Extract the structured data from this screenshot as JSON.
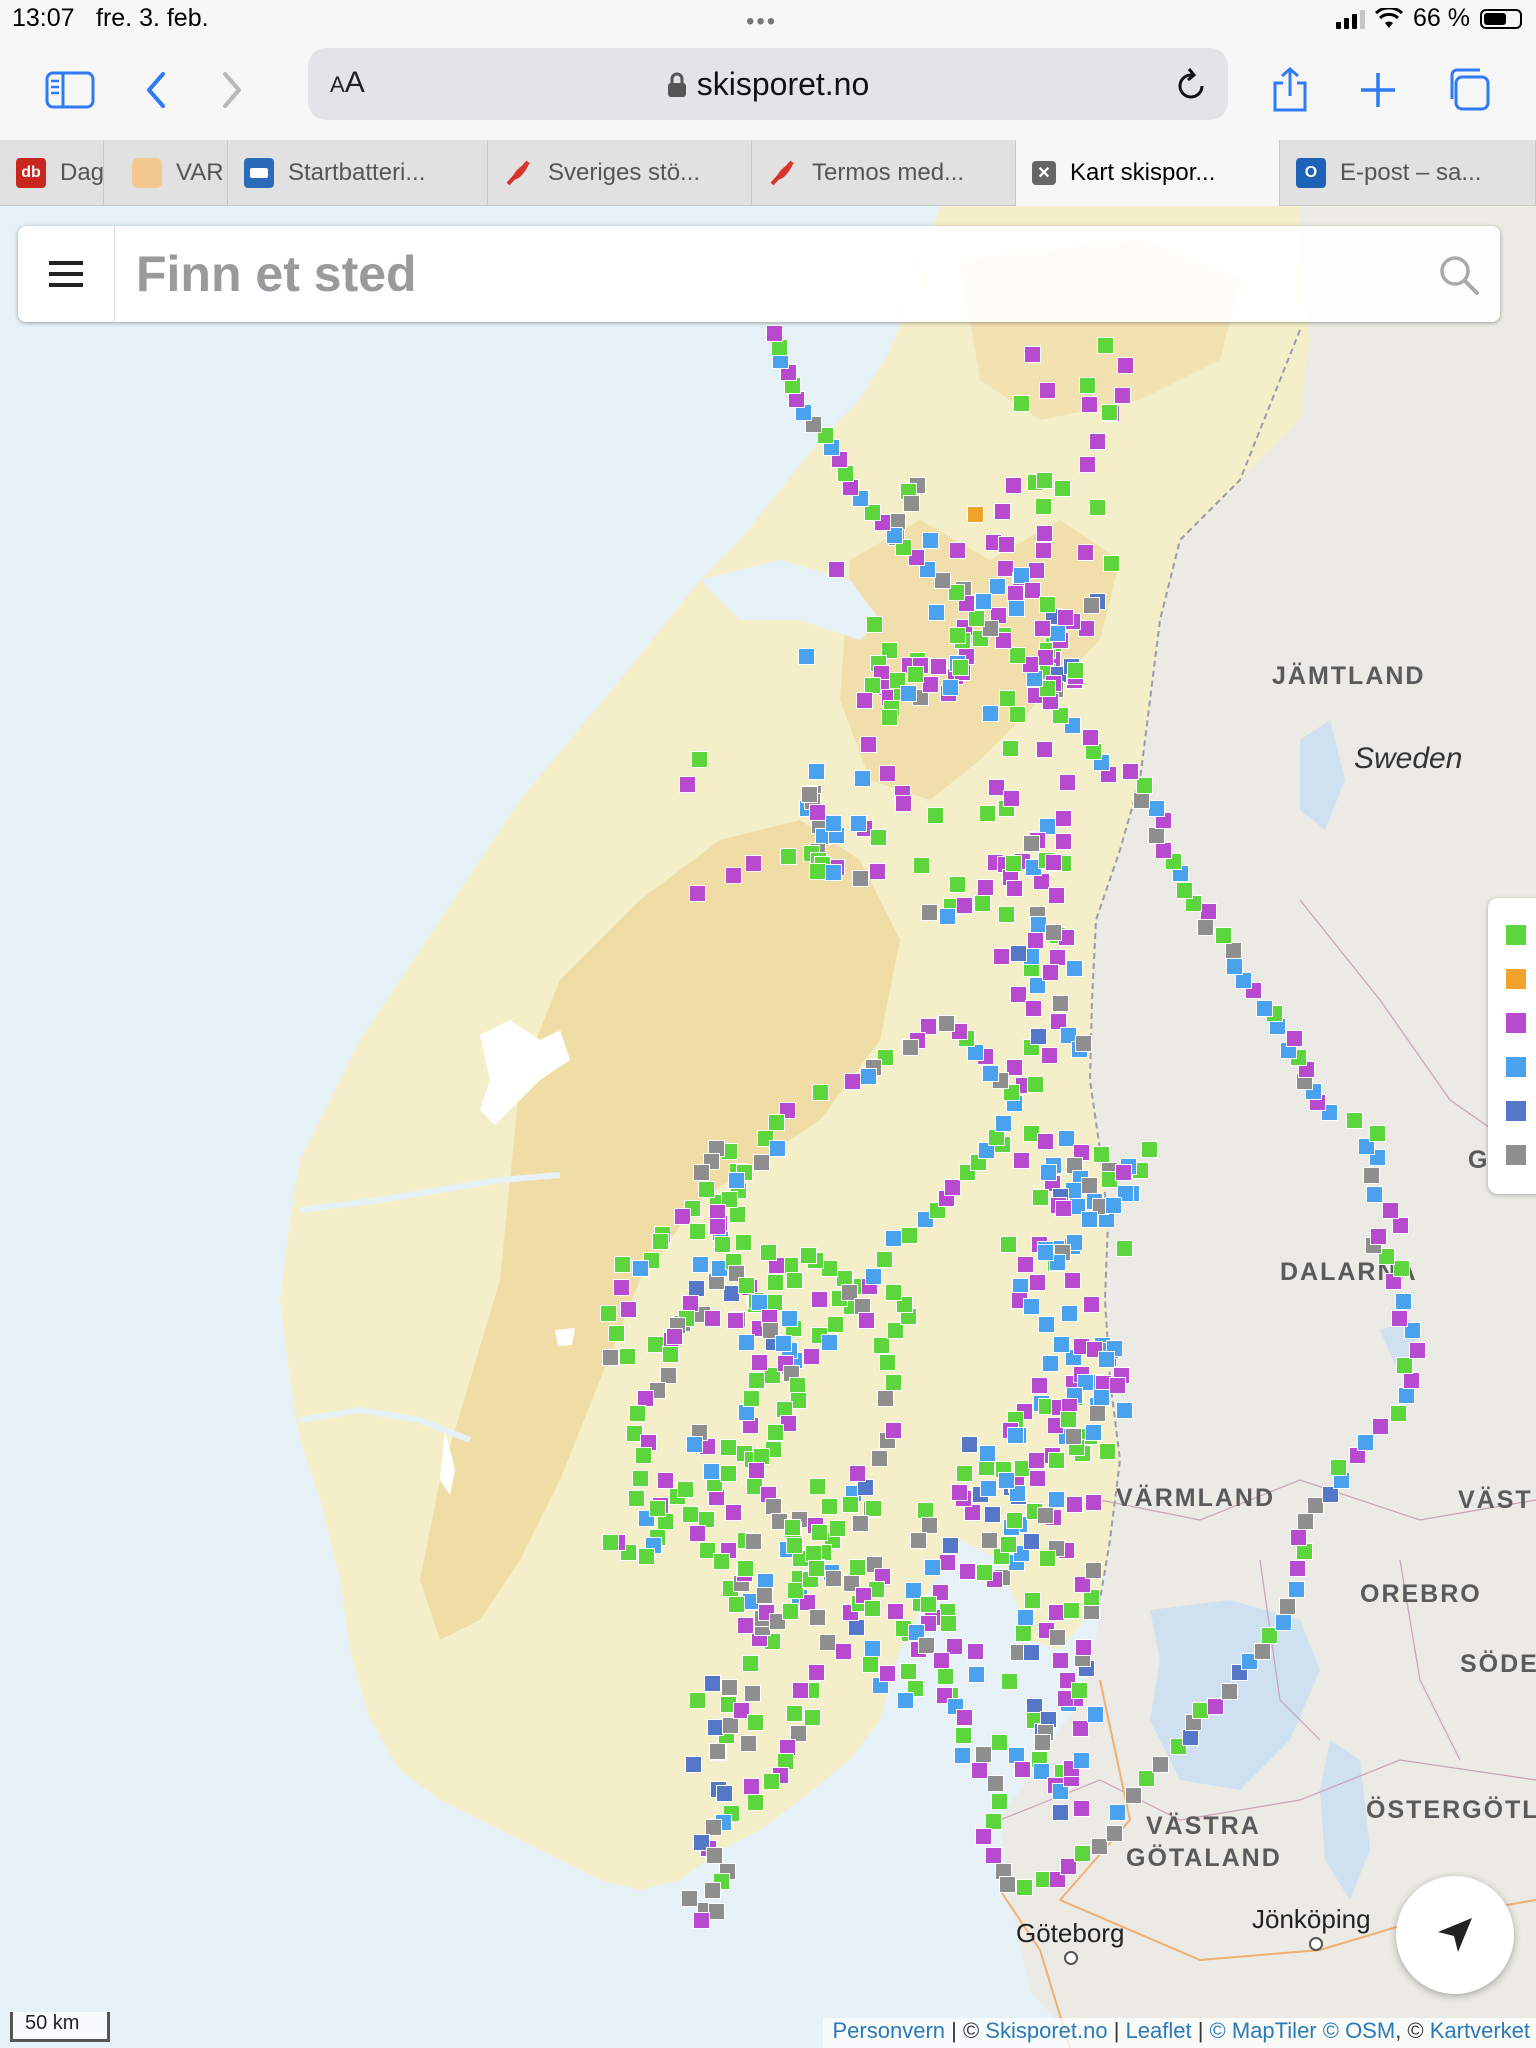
{
  "status_bar": {
    "time": "13:07",
    "date": "fre. 3. feb.",
    "battery": "66 %",
    "battery_level": 0.66
  },
  "browser": {
    "aa_label": "AA",
    "url": "skisporet.no",
    "tabs": [
      {
        "title": "Dag",
        "icon": "db-favicon",
        "color": "#c8261e",
        "text": "db"
      },
      {
        "title": "VAR",
        "icon": "var-favicon",
        "color": "#f2b86a",
        "text": ""
      },
      {
        "title": "Startbatteri...",
        "icon": "startbatteri-favicon",
        "color": "#2c6bb8",
        "text": ""
      },
      {
        "title": "Sveriges stö...",
        "icon": "feather-favicon",
        "color": "#d9332b",
        "text": ""
      },
      {
        "title": "Termos med...",
        "icon": "feather-favicon",
        "color": "#d9332b",
        "text": ""
      },
      {
        "title": "Kart skispor...",
        "icon": "close-tab-icon",
        "color": "#666666",
        "text": "",
        "active": true
      },
      {
        "title": "E-post – sa...",
        "icon": "outlook-favicon",
        "color": "#1e62b8",
        "text": ""
      }
    ]
  },
  "search": {
    "placeholder": "Finn et sted"
  },
  "map_labels": {
    "jamtland": "JÄMTLAND",
    "sweden": "Sweden",
    "dalarna": "DALARNA",
    "varmland": "VÄRMLAND",
    "vast": "VÄST",
    "orebro": "OREBRO",
    "sode": "SÖDE",
    "vastra_gotaland_1": "VÄSTRA",
    "vastra_gotaland_2": "GÖTALAND",
    "ostergotl": "ÖSTERGÖTL",
    "goteborg": "Göteborg",
    "jonkoping": "Jönköping",
    "g_partial": "G"
  },
  "legend_colors": [
    "#5cd63c",
    "#f0a22a",
    "#b84ad0",
    "#4aa2ef",
    "#5577c8",
    "#8e8e8e"
  ],
  "marker_palette": {
    "g": "#5cd63c",
    "o": "#f0a22a",
    "p": "#b84ad0",
    "b": "#4aa2ef",
    "d": "#5577c8",
    "y": "#8e8e8e"
  },
  "markers": "p1032,354 g1105,345 p1125,365 p1047,390 g1087,385 g1021,403 p1089,404 p1122,395 p1111,413 g1109,412 p1097,441 p1087,464 p1013,485 g1035,482 g1044,480 g1062,488 y917,485 o975,514 p1002,511 g1043,506 g1097,507 g908,491 y911,503 y897,521 y896,537 b930,540 p957,550 p993,542 p1006,544 p1043,550 p1044,533 p1085,552 g1111,563 p1036,570 p1005,568 p1020,580 p836,569 y963,589 b997,586 p1015,593 b1016,608 b1021,575 p1032,590 p1086,628 d1097,601 y1091,605 p1072,621 p964,627 g1003,635 p998,615 b983,601 b936,612 g1003,635 g874,624 g889,650 g917,660 p939,666 p966,656 g980,638 p1058,638 g1053,645 p1052,659 g1047,671 p909,665 g878,663 p881,673 p886,687 p889,697 g901,693 g897,680 p920,665 p938,666 p955,676 p948,693 y920,697 b908,693 p930,684 p962,672 b950,687 g915,674 g872,685 b957,663 g962,640 g960,667 g891,708 p864,700 g889,717 d1058,674 p1074,680 y1055,689 p1075,676 d1071,666 g1047,650 d1053,616 p1065,617 g957,635 b990,713 g1017,714 p1053,683 p1035,695 g1075,670 p1045,657 p1060,640 b1057,633 p1042,628 g1047,604 g1007,698 g1010,748 p1044,749 p1067,782 p996,787 g1006,808 p1063,818 y1037,839 b1047,826 p1063,841 g1058,863 p1041,881 b806,656 g699,759 p687,784 b816,771 b862,778 p868,744 p887,773 p902,793 g935,815 g951,906 y929,912 p964,905 b947,916 p995,862 p1005,864 p1022,861 b1033,867 g1063,863 p1010,877 p1014,888 p1037,840 g1046,860 p1053,862 y1031,843 g957,884 p877,871 p836,867 g788,856 p753,863 p697,893 p733,875 y813,793 y819,825 b823,836 b807,808 y812,801 y817,851 p864,828 g811,853 b836,835 g818,860 g822,864 g817,871 b833,872 y860,878 p817,812 y809,794 b858,823 b833,823 p903,803 g878,837 g921,865 g987,813 p1011,798 g1013,863 p985,887 g982,903 g1006,914 p1056,895 y1037,914 g1057,935 p1001,956 b1038,924 p1066,937 p1018,994 g1031,968 b1037,985 y1053,932 p1035,940 b1031,956 p1057,957 b1074,968 d1018,953 p1050,972 p1033,1008 p1058,1021 b1068,1035 b1079,1049 y1060,1003 g1031,1047 y1083,1043 p1023,1085 p1049,1055 g1035,1084 d1038,1036 p1014,1067 b1066,1138 g1031,1133 p1045,1141 g1002,1144 p1021,1160 p1081,1152 b1053,1165 y1074,1165 y1109,1170 b1080,1178 p1052,1183 g1101,1154 b1073,1190 y1089,1185 b1048,1172 d1060,1196 g1040,1197 p1058,1205 b1077,1206 g1109,1179 b1094,1201 b1106,1219 p1063,1208 p1039,1244 b1061,1248 b1072,1246 g1149,1149 g1140,1170 b1128,1166 p1123,1172 b1131,1193 y1100,1206 b1125,1193 b1113,1205 b1089,1219 b1074,1242 g1124,1248 g1055,1263 b1045,1249 y1062,1252 p1072,1280 b1057,1262 b1045,1252 p1025,1264 g1008,1244 b1020,1286 p1037,1282 p1019,1300 b1031,1306 b1046,1324 b1069,1313 p1091,1304 b1073,1357 b1061,1344 p1073,1383 p1081,1346 b1050,1363 p1039,1385 b1041,1403 p1024,1411 g1015,1419 g1046,1406 p1059,1407 b1066,1436 b1094,1382 p1108,1358 b1097,1405 g1089,1436 p1055,1425 g1082,1453 g1107,1451 g986,1467 b1018,1435 p1010,1430 d1011,1487 g1022,1468 p1053,1517 p1093,1502 y1097,1413 b1093,1432 p1103,1383 b1102,1345 b1110,1350 p1094,1349 g1075,1397 p1081,1374 p1121,1375 b1114,1348 b1106,1359 b1085,1382 b1074,1395 b1101,1397 p1117,1385 b1124,1410 p1069,1406 g1068,1419 p1036,1460 g1003,1469 p1016,1484 d1018,1496 d980,1494 d992,1514 p972,1512 y989,1540 d950,1545 p967,1571 y1002,1577 b1016,1562 p994,1579 g1001,1556 b1021,1553 g984,1572 p940,1592 g920,1603 b913,1590 g947,1611 g948,1623 p932,1617 p954,1646 g950,1695 g1009,1681 b976,1674 p975,1651 y1018,1652 g1023,1633 b1025,1617 g1032,1600 p1046,1630 d1031,1652 p1060,1660 p1067,1680 b1068,1703 d1034,1706 g1034,1720 d1042,1731 d1048,1719 y1045,1732 y1042,1742 g999,1742 b1016,1755 y983,1754 p1022,1769 g1039,1759 b1041,1771 g1062,1772 p1055,1785 p1081,1808 b1060,1791 d1060,1812 p1071,1778 p1071,1768 b1081,1760 p1080,1728 b1095,1714 p1075,1698 p1065,1698 g1079,1690 d1086,1668 y1082,1658 p1083,1647 y1057,1637 p1056,1612 y1091,1611 g1071,1610 g1091,1597 p1082,1584 y1093,1570 p1066,1550 y1056,1548 g1047,1558 d1031,1541 b1019,1524 b1011,1527 g1008,1544 g1014,1520 b1017,1493 g1034,1511 y1045,1515 b1056,1499 p1074,1504 p1037,1478 b1006,1480 b988,1488 p963,1498 b987,1453 p1052,1455 g1056,1460 g1076,1447 y1073,1436 b1015,1435 d969,1444 g964,1473 p959,1492 g925,1510 y929,1525 y918,1540 p947,1562 b932,1567 g928,1604 p928,1623 g909,1633 p918,1649 g908,1671 g915,1688 b905,1700 b880,1685 p887,1673 g870,1664 b872,1648 d856,1627 p850,1612 g859,1603 p851,1582 g857,1567 y874,1564 p882,1576 g876,1589 y871,1509 g873,1508 g829,1506 b853,1493 g817,1486 y799,1519 p815,1525 g832,1540 g823,1552 b831,1572 p816,1567 g799,1578 b787,1549 b799,1597 p807,1602 y817,1617 y827,1642 p843,1651 p816,1672 g811,1690 p800,1690 g794,1713 g812,1717 y798,1733 p787,1747 g785,1761 p780,1775 g771,1781 p751,1786 g755,1802 g731,1813 b723,1822 y713,1827 p708,1848 d701,1842 y714,1855 y727,1871 g721,1881 y712,1890 y689,1898 y705,1910 y716,1911 p701,1920 d718,1789 d724,1793 d693,1764 g718,1752 g726,1735 y717,1751 y748,1743 d715,1727 y730,1725 g697,1700 g728,1704 d712,1683 y729,1687 y752,1693 p741,1710 g755,1722 g750,1663 g772,1641 p759,1638 y762,1627 p745,1625 y762,1618 b750,1601 g736,1604 g730,1588 y741,1583 p744,1573 p728,1550 g745,1540 y753,1541 p733,1512 p716,1497 g714,1483 g728,1473 b711,1471 p707,1446 y699,1432 b694,1444 g728,1447 g744,1453 g752,1459 p750,1425 b746,1412 g751,1398 g756,1380 g772,1375 y789,1366 b794,1360 b789,1350 p811,1356 g819,1335 g835,1324 g851,1306 g861,1286 g844,1278 g829,1268 g815,1260 g808,1255 g790,1265 g794,1280 p819,1299 g839,1298 y849,1292 y862,1306 p866,1320 b829,1342 g793,1328 p759,1328 y737,1319 g755,1304 p749,1287 g775,1282 p776,1265 g768,1252 g743,1242 b720,1232 g737,1214 p719,1223 g717,1202 g738,1190 g737,1171 g729,1151 y716,1148 y711,1161 y701,1172 g706,1189 g692,1208 p682,1216 g697,1231 g662,1234 g660,1241 g651,1260 b640,1268 g622,1264 p621,1287 p628,1309 g608,1313 g616,1333 y610,1357 g627,1356 g655,1344 p671,1340 y682,1323 y702,1314 p712,1318 p735,1320 b746,1342 p759,1362 d773,1342 b789,1318 g774,1302 g756,1300 d731,1293 y716,1281 b719,1268 b700,1264 d696,1288 p690,1303 g686,1318 y677,1325 p674,1336 g670,1354 y668,1375 y657,1390 p645,1398 g637,1413 g634,1433 p648,1442 g643,1455 g640,1478 g636,1498 p660,1505 g665,1521 g657,1537 b653,1545 g646,1556 g628,1552 p617,1542 g610,1542 b646,1518 g657,1508 g677,1496 p665,1480 g685,1489 g690,1514 g706,1519 p697,1533 g707,1550 g721,1561 g745,1568 b765,1581 y764,1595 p766,1612 y777,1621 g790,1611 g795,1590 g810,1579 g800,1558 g793,1529 g819,1532 g837,1528 y860,1523 g850,1504 d865,1487 p857,1473 y879,1458 y887,1440 p893,1430 y885,1398 g893,1382 g887,1362 g881,1345 g895,1330 g908,1316 g904,1304 g893,1292 p869,1286 b873,1276 g884,1259 b893,1238 g909,1235 b925,1219 g937,1210 p946,1198 p952,1187 g967,1172 g978,1162 b986,1150 g996,1137 b1003,1123 b1014,1103 g1011,1092 y1000,1080 b990,1073 p985,1056 b975,1052 g966,1038 p959,1031 y946,1023 p928,1026 p917,1040 y910,1047 g885,1057 y873,1067 b868,1076 p852,1081 g820,1092 p787,1110 g776,1122 g765,1138 b777,1148 y761,1162 g744,1172 b736,1180 g729,1199 p717,1212 p717,1226 g722,1244 g733,1261 y736,1273 g746,1285 b759,1302 p769,1317 y770,1330 b783,1343 p785,1363 y791,1373 g797,1385 g798,1400 g784,1409 p788,1423 g775,1432 g773,1449 g761,1456 p756,1470 g754,1486 p768,1494 y773,1506 y779,1521 g792,1527 g794,1545 g813,1553 g816,1568 y833,1578 y851,1583 p863,1595 g872,1608 p895,1611 g903,1628 b916,1632 y926,1645 p941,1660 g945,1676 p944,1695 b955,1706 p964,1717 g963,1735 b962,1755 p979,1770 y995,1783 g999,1801 g993,1821 p983,1836 p993,1855 y1003,1871 y1007,1884 g1024,1887 g1043,1879 p1057,1879 p1068,1866 g1082,1853 y1099,1846 y1114,1833 b1117,1812 y1133,1795 g1146,1778 y1160,1764 g1178,1746 d1190,1737 y1193,1722 g1200,1710 p1215,1706 y1229,1691 d1239,1672 b1249,1661 y1262,1651 g1269,1635 b1283,1622 y1287,1606 b1296,1589 p1297,1568 g1304,1551 p1298,1537 y1305,1521 y1315,1505 d1330,1494 b1341,1480 g1338,1467 p1357,1455 b1365,1442 p1380,1426 g1398,1413 b1406,1395 p1411,1380 g1404,1365 p1417,1350 b1412,1330 p1399,1318 b1403,1301 p1393,1281 g1401,1268 g1386,1256 y1373,1245 p1378,1236 p1400,1225 p1390,1210 b1374,1194 y1371,1175 b1377,1157 b1366,1146 g1377,1133 g1354,1120 b1329,1112 p1317,1102 b1313,1091 y1304,1081 p1306,1069 g1298,1057 b1288,1050 p1294,1038 b1277,1026 g1274,1013 b1264,1008 p1253,990 b1243,980 b1234,966 y1233,950 g1223,935 y1205,927 p1208,911 g1193,903 g1184,890 b1180,873 g1173,861 p1163,850 y1156,835 p1163,820 b1156,808 y1141,800 g1144,785 p1130,771 p1108,774 b1101,762 g1093,751 p1090,737 b1072,725 g1060,715 p1050,701 g1047,688 b1034,678 p1030,664 g1017,655 p1003,640 y990,628 g976,618 p966,603 g956,592 y942,580 b927,569 p916,557 g903,547 b894,535 p882,522 g872,512 b860,498 p850,487 g845,473 p839,459 b831,447 g825,435 y813,424 b803,412 p796,399 g792,385 p788,372 b780,360 g779,347 p774,333 g766,320 b756,309 p748,296 g742,283 p737,270 b729,257 g727,245 p722,232 g716,218 y710,206 b702,194 p698,181 g693,169",
  "footer": {
    "scale_label": "50 km",
    "attribution": {
      "personvern": "Personvern",
      "sep1": " | © ",
      "skisporet": "Skisporet.no",
      "sep2": " | ",
      "leaflet": "Leaflet",
      "sep3": " | ",
      "maptiler": "© MapTiler",
      "osm": "© OSM",
      "sep4": ", © ",
      "kartverket": "Kartverket"
    }
  }
}
